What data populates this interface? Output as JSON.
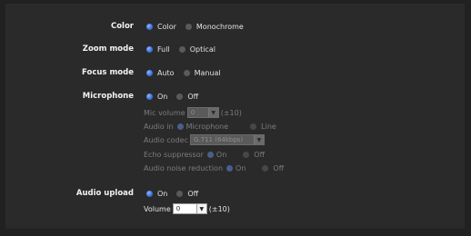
{
  "color": {
    "label": "Color",
    "options": [
      {
        "text": "Color",
        "selected": true
      },
      {
        "text": "Monochrome",
        "selected": false
      }
    ]
  },
  "zoom_mode": {
    "label": "Zoom mode",
    "options": [
      {
        "text": "Full",
        "selected": true
      },
      {
        "text": "Optical",
        "selected": false
      }
    ]
  },
  "focus_mode": {
    "label": "Focus mode",
    "options": [
      {
        "text": "Auto",
        "selected": true
      },
      {
        "text": "Manual",
        "selected": false
      }
    ]
  },
  "microphone": {
    "label": "Microphone",
    "options": [
      {
        "text": "On",
        "selected": true
      },
      {
        "text": "Off",
        "selected": false
      }
    ],
    "mic_volume": {
      "label": "Mic volume",
      "value": "0",
      "hint": "(±10)"
    },
    "audio_in": {
      "label": "Audio in",
      "options": [
        {
          "text": "Microphone",
          "selected": true
        },
        {
          "text": "Line",
          "selected": false
        }
      ]
    },
    "audio_codec": {
      "label": "Audio codec",
      "value": "G.711 (64kbps)"
    },
    "echo_suppressor": {
      "label": "Echo suppressor",
      "options": [
        {
          "text": "On",
          "selected": true
        },
        {
          "text": "Off",
          "selected": false
        }
      ]
    },
    "noise_reduction": {
      "label": "Audio noise reduction",
      "options": [
        {
          "text": "On",
          "selected": true
        },
        {
          "text": "Off",
          "selected": false
        }
      ]
    }
  },
  "audio_upload": {
    "label": "Audio upload",
    "options": [
      {
        "text": "On",
        "selected": true
      },
      {
        "text": "Off",
        "selected": false
      }
    ],
    "volume": {
      "label": "Volume",
      "value": "0",
      "hint": "(±10)"
    }
  }
}
